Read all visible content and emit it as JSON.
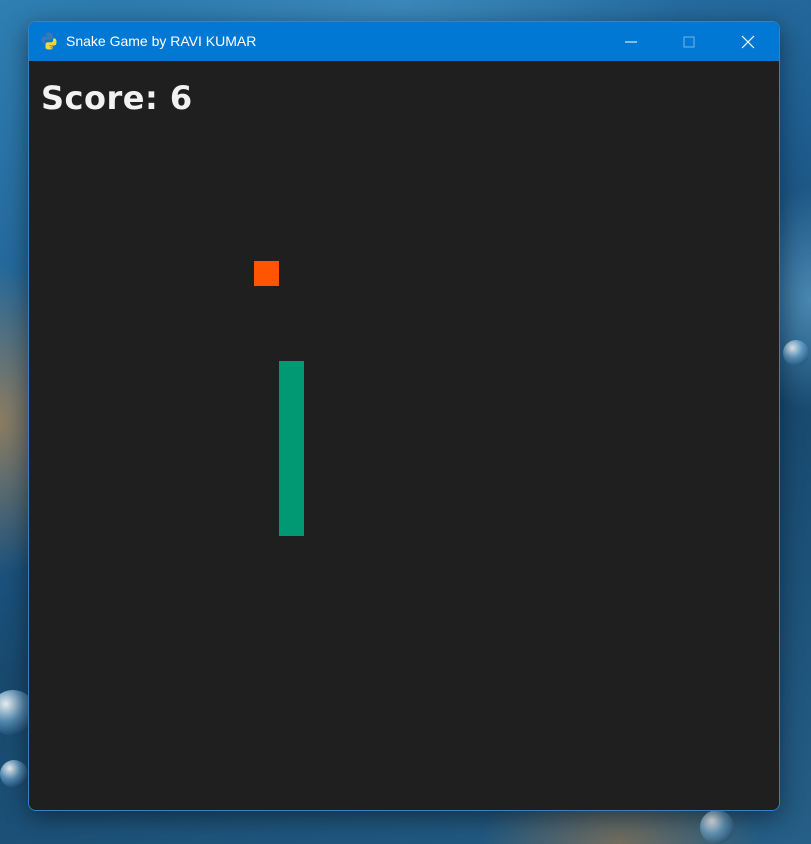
{
  "window": {
    "title": "Snake Game by RAVI KUMAR",
    "app_icon": "python-icon",
    "controls": {
      "minimize_icon": "minimize-icon",
      "maximize_icon": "maximize-icon",
      "close_icon": "close-icon"
    },
    "titlebar_color": "#0078d4"
  },
  "game": {
    "score_text": "Score: 6",
    "background_color": "#1f1f1f",
    "food_color": "#ff5500",
    "snake_color": "#009973",
    "snake_length": 7
  }
}
